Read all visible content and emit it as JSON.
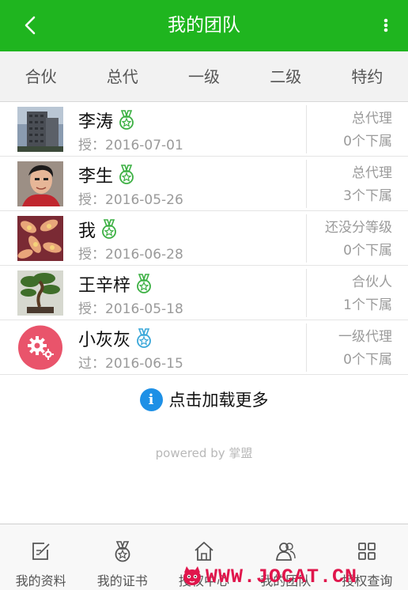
{
  "header": {
    "title": "我的团队"
  },
  "tabs": [
    {
      "label": "合伙"
    },
    {
      "label": "总代"
    },
    {
      "label": "一级"
    },
    {
      "label": "二级"
    },
    {
      "label": "特约"
    }
  ],
  "members": [
    {
      "name": "李涛",
      "date": "授：2016-07-01",
      "level": "总代理",
      "count": "0个下属",
      "avatar": "building-photo",
      "medal_color": "#3cb043"
    },
    {
      "name": "李生",
      "date": "授：2016-05-26",
      "level": "总代理",
      "count": "3个下属",
      "avatar": "man-photo",
      "medal_color": "#3cb043"
    },
    {
      "name": "我",
      "date": "授：2016-06-28",
      "level": "还没分等级",
      "count": "0个下属",
      "avatar": "flowers-photo",
      "medal_color": "#3cb043"
    },
    {
      "name": "王辛梓",
      "date": "授：2016-05-18",
      "level": "合伙人",
      "count": "1个下属",
      "avatar": "bonsai-photo",
      "medal_color": "#3cb043"
    },
    {
      "name": "小灰灰",
      "date": "过：2016-06-15",
      "level": "一级代理",
      "count": "0个下属",
      "avatar": "gear-avatar",
      "medal_color": "#3aa7d9"
    }
  ],
  "load_more": "点击加载更多",
  "powered_by": "powered by 掌盟",
  "bottom_nav": [
    {
      "label": "我的资料",
      "icon": "edit-icon"
    },
    {
      "label": "我的证书",
      "icon": "medal-icon"
    },
    {
      "label": "授权中心",
      "icon": "home-icon"
    },
    {
      "label": "我的团队",
      "icon": "team-icon"
    },
    {
      "label": "授权查询",
      "icon": "grid-icon"
    }
  ],
  "watermark": "WWW.JOCAT.CN",
  "colors": {
    "brand_green": "#1fb51f",
    "info_blue": "#1e90e6",
    "watermark_red": "#e0164c"
  }
}
